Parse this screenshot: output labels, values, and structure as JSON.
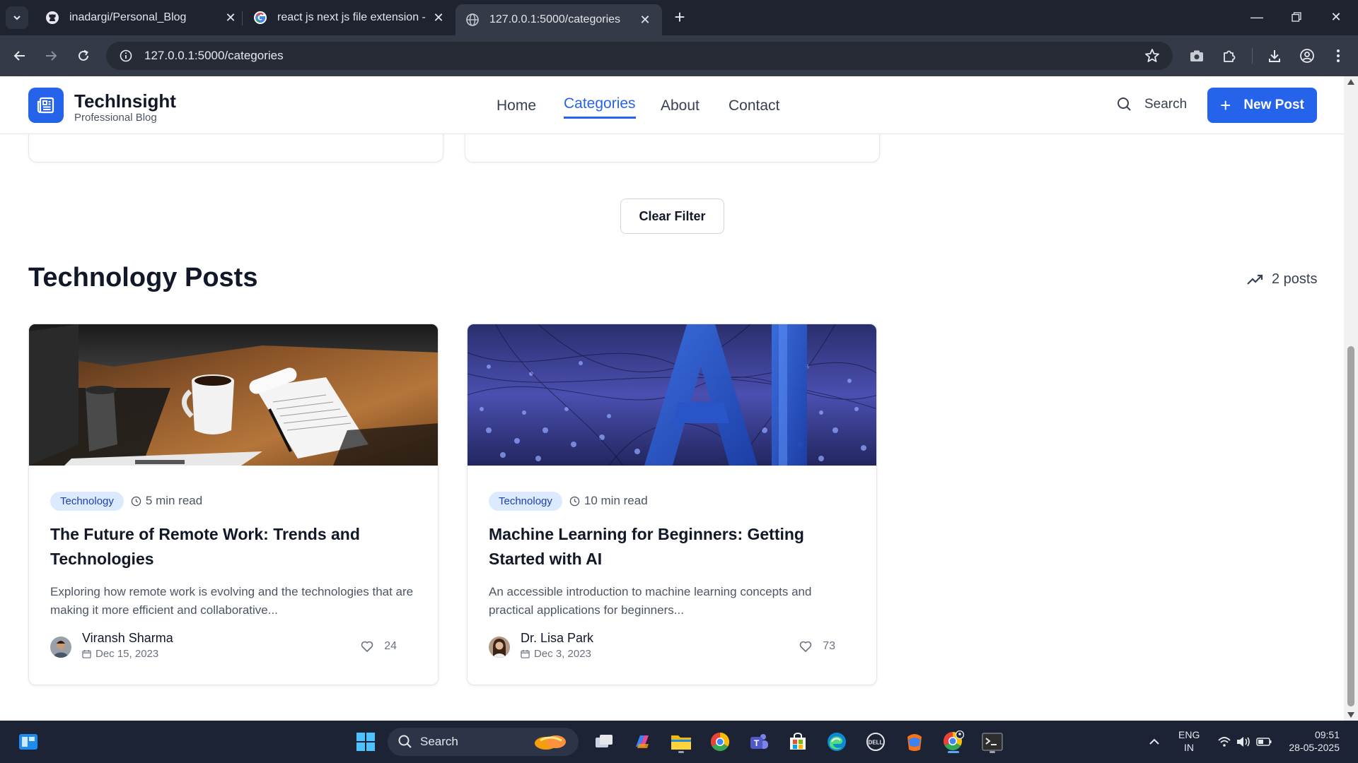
{
  "browser": {
    "tabs": [
      {
        "title": "inadargi/Personal_Blog",
        "icon": "github-icon",
        "active": false
      },
      {
        "title": "react js next js file extension - G",
        "icon": "google-icon",
        "active": false
      },
      {
        "title": "127.0.0.1:5000/categories",
        "icon": "globe-icon",
        "active": true
      }
    ],
    "url": "127.0.0.1:5000/categories"
  },
  "site": {
    "brand": {
      "title": "TechInsight",
      "subtitle": "Professional Blog"
    },
    "nav": [
      {
        "label": "Home",
        "active": false
      },
      {
        "label": "Categories",
        "active": true
      },
      {
        "label": "About",
        "active": false
      },
      {
        "label": "Contact",
        "active": false
      }
    ],
    "search_label": "Search",
    "new_post_label": "New Post",
    "accent_color": "#2563eb"
  },
  "main": {
    "clear_filter_label": "Clear Filter",
    "section_title": "Technology Posts",
    "post_count": "2 posts",
    "posts": [
      {
        "category": "Technology",
        "read_time": "5 min read",
        "title": "The Future of Remote Work: Trends and Technologies",
        "excerpt": "Exploring how remote work is evolving and the technologies that are making it more efficient and collaborative...",
        "author": "Viransh Sharma",
        "date": "Dec 15, 2023",
        "likes": "24",
        "image": "desk-coffee-laptop"
      },
      {
        "category": "Technology",
        "read_time": "10 min read",
        "title": "Machine Learning for Beginners: Getting Started with AI",
        "excerpt": "An accessible introduction to machine learning concepts and practical applications for beginners...",
        "author": "Dr. Lisa Park",
        "date": "Dec 3, 2023",
        "likes": "73",
        "image": "ai-letters-network"
      }
    ]
  },
  "taskbar": {
    "search_label": "Search",
    "lang_top": "ENG",
    "lang_bottom": "IN",
    "time": "09:51",
    "date": "28-05-2025"
  }
}
